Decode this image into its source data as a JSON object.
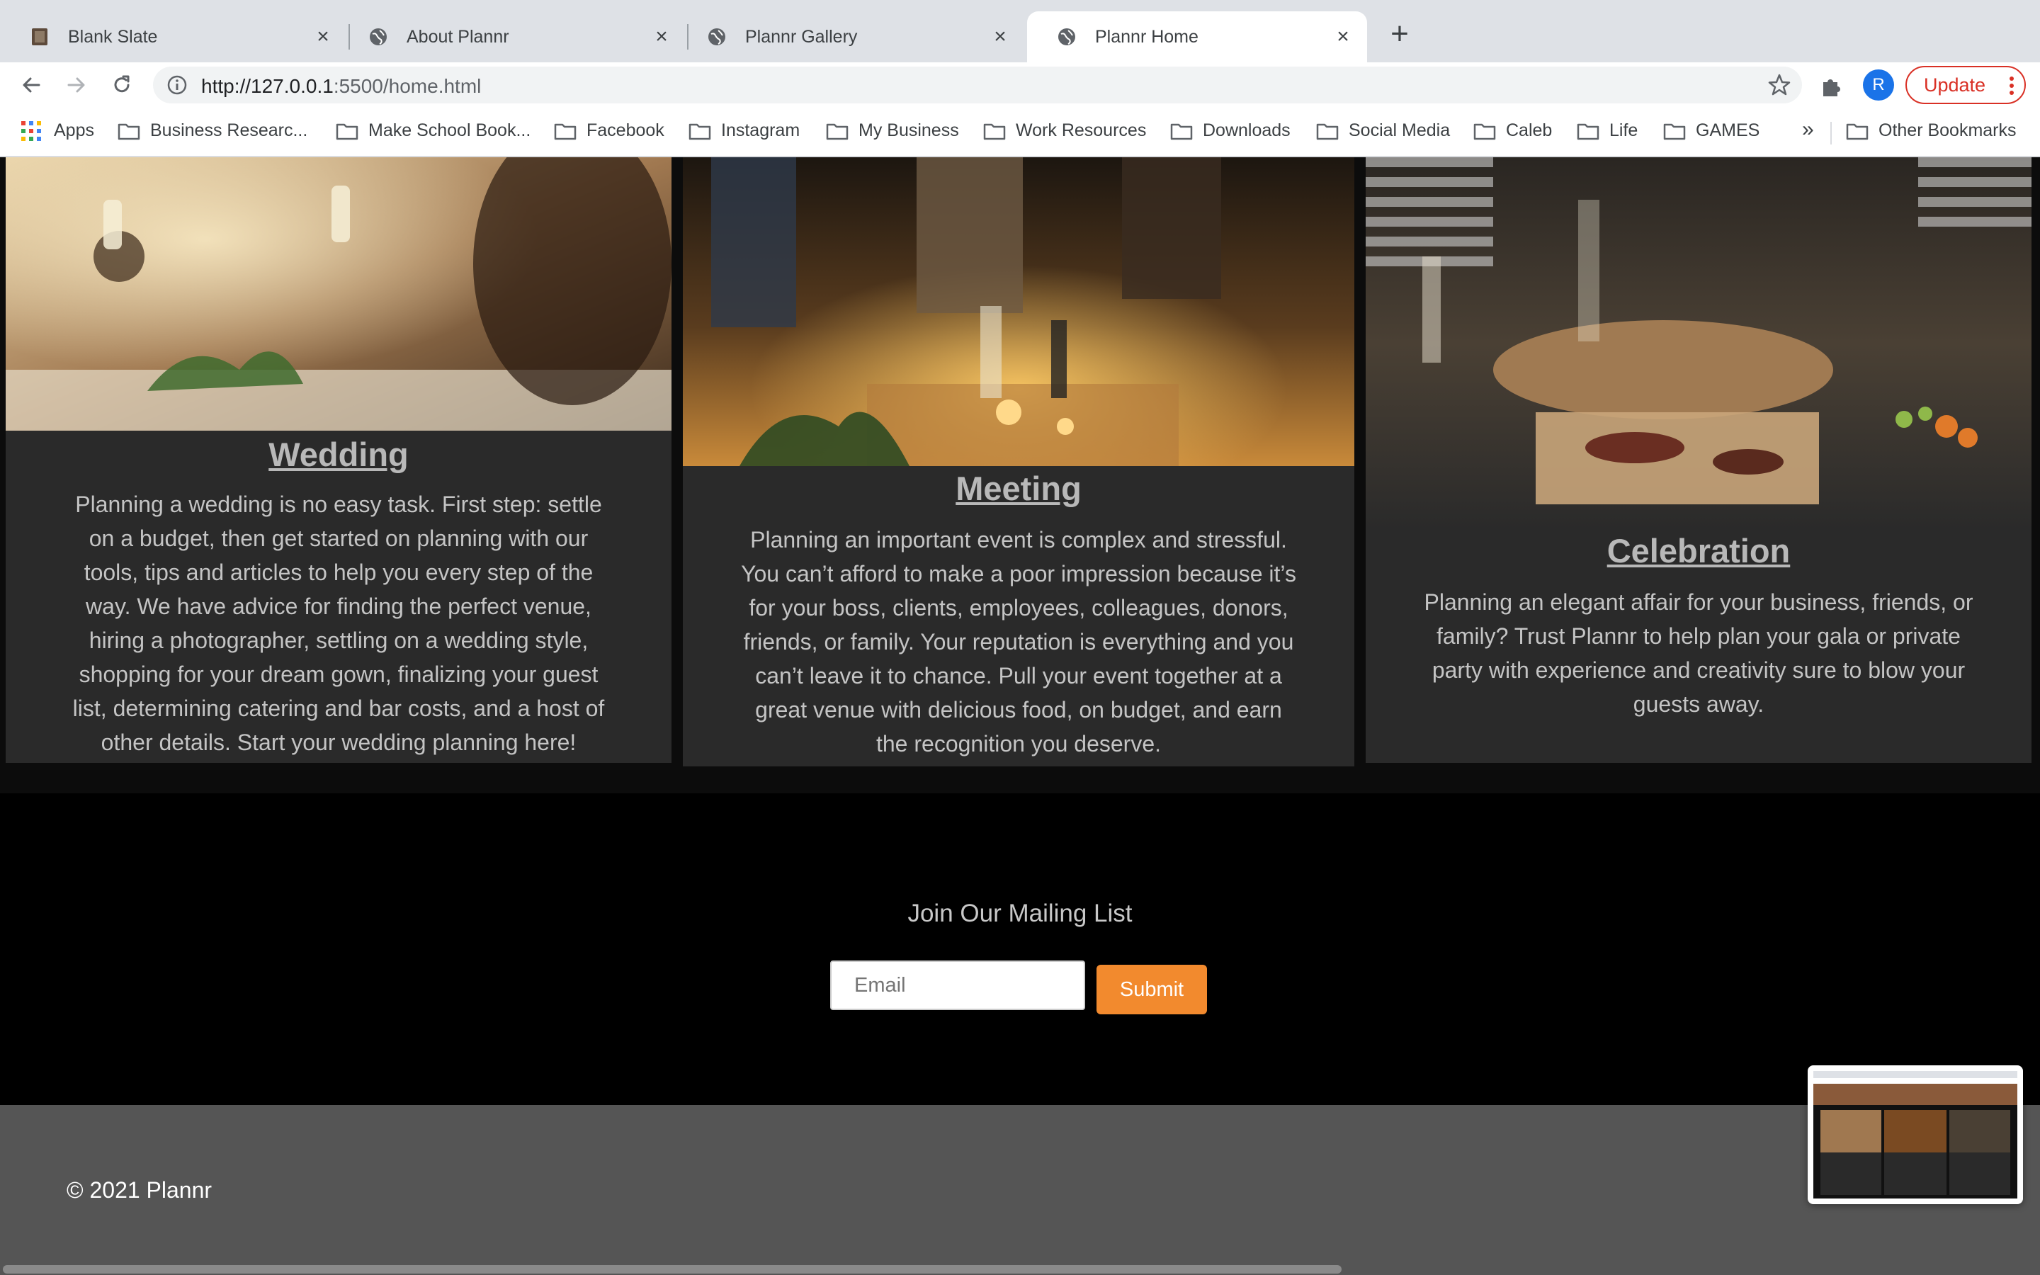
{
  "browser": {
    "tabs": [
      {
        "title": "Blank Slate",
        "icon": "blank-slate-favicon",
        "active": false
      },
      {
        "title": "About Plannr",
        "icon": "globe-icon",
        "active": false
      },
      {
        "title": "Plannr Gallery",
        "icon": "globe-icon",
        "active": false
      },
      {
        "title": "Plannr Home",
        "icon": "globe-icon",
        "active": true
      }
    ],
    "url_host": "http://127.0.0.1",
    "url_rest": ":5500/home.html",
    "avatar_letter": "R",
    "update_label": "Update",
    "bookmarks": [
      {
        "label": "Apps",
        "icon": "apps-grid-icon"
      },
      {
        "label": "Business Researc...",
        "icon": "folder-icon"
      },
      {
        "label": "Make School Book...",
        "icon": "folder-icon"
      },
      {
        "label": "Facebook",
        "icon": "folder-icon"
      },
      {
        "label": "Instagram",
        "icon": "folder-icon"
      },
      {
        "label": "My Business",
        "icon": "folder-icon"
      },
      {
        "label": "Work Resources",
        "icon": "folder-icon"
      },
      {
        "label": "Downloads",
        "icon": "folder-icon"
      },
      {
        "label": "Social Media",
        "icon": "folder-icon"
      },
      {
        "label": "Caleb",
        "icon": "folder-icon"
      },
      {
        "label": "Life",
        "icon": "folder-icon"
      },
      {
        "label": "GAMES",
        "icon": "folder-icon"
      }
    ],
    "bookmarks_overflow": "»",
    "other_bookmarks": "Other Bookmarks"
  },
  "cards": [
    {
      "title": "Wedding",
      "text": "Planning a wedding is no easy task. First step: settle on a budget, then get started on planning with our tools, tips and articles to help you every step of the way. We have advice for finding the perfect venue, hiring a photographer, settling on a wedding style, shopping for your dream gown, finalizing your guest list, determining catering and bar costs, and a host of other details. Start your wedding planning here!"
    },
    {
      "title": "Meeting",
      "text": "Planning an important event is complex and stressful. You can’t afford to make a poor impression because it’s for your boss, clients, employees, colleagues, donors, friends, or family. Your reputation is everything and you can’t leave it to chance. Pull your event together at a great venue with delicious food, on budget, and earn the recognition you deserve."
    },
    {
      "title": "Celebration",
      "text": "Planning an elegant affair for your business, friends, or family? Trust Plannr to help plan your gala or private party with experience and creativity sure to blow your guests away."
    }
  ],
  "mailing": {
    "heading": "Join Our Mailing List",
    "email_placeholder": "Email",
    "submit_label": "Submit"
  },
  "footer": {
    "copyright": "© 2021 Plannr"
  },
  "colors": {
    "accent": "#f28a2e",
    "card_bg": "#2a2a2a",
    "footer_bg": "#555555"
  }
}
